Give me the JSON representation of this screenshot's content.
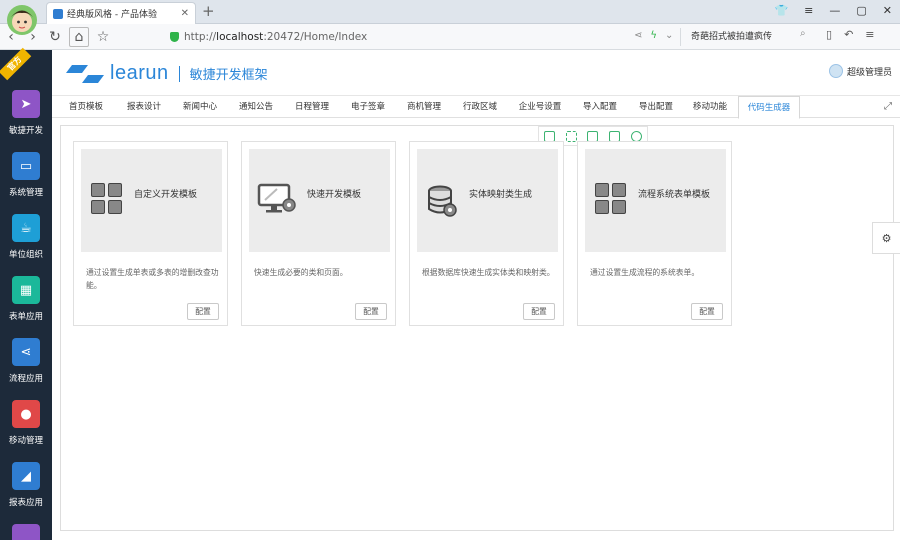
{
  "browser": {
    "tab_title": "经典版风格 - 产品体验",
    "new_tab": "+",
    "url_prefix": "http://",
    "url_host": "localhost",
    "url_path": ":20472/Home/Index",
    "search_hint": "奇葩招式被拍遭疯传",
    "window_controls": [
      "minimize",
      "maximize",
      "close"
    ]
  },
  "sidebar": {
    "ribbon": "官方",
    "items": [
      {
        "label": "敏捷开发",
        "icon": "paper-plane-icon",
        "color": "#8e55c6"
      },
      {
        "label": "系统管理",
        "icon": "monitor-icon",
        "color": "#2f7dd1"
      },
      {
        "label": "单位组织",
        "icon": "coffee-cup-icon",
        "color": "#1e9fd6"
      },
      {
        "label": "表单应用",
        "icon": "table-icon",
        "color": "#1bb89a"
      },
      {
        "label": "流程应用",
        "icon": "share-icon",
        "color": "#2f7dd1"
      },
      {
        "label": "移动管理",
        "icon": "android-icon",
        "color": "#e04848"
      },
      {
        "label": "报表应用",
        "icon": "chart-icon",
        "color": "#2f7dd1"
      }
    ]
  },
  "header": {
    "brand_name": "learun",
    "brand_subtitle": "敏捷开发框架",
    "user_name": "超级管理员"
  },
  "tabs": [
    "首页模板",
    "报表设计",
    "新闻中心",
    "通知公告",
    "日程管理",
    "电子签章",
    "商机管理",
    "行政区域",
    "企业号设置",
    "导入配置",
    "导出配置",
    "移动功能",
    "代码生成器"
  ],
  "active_tab": "代码生成器",
  "cards": [
    {
      "title": "自定义开发模板",
      "desc": "通过设置生成单表或多表的增删改查功能。",
      "button": "配置",
      "icon": "grid-blocks-icon"
    },
    {
      "title": "快速开发模板",
      "desc": "快速生成必要的类和页面。",
      "button": "配置",
      "icon": "monitor-gear-icon"
    },
    {
      "title": "实体映射类生成",
      "desc": "根据数据库快速生成实体类和映射类。",
      "button": "配置",
      "icon": "database-icon"
    },
    {
      "title": "流程系统表单模板",
      "desc": "通过设置生成流程的系统表单。",
      "button": "配置",
      "icon": "grid-blocks-icon"
    }
  ]
}
